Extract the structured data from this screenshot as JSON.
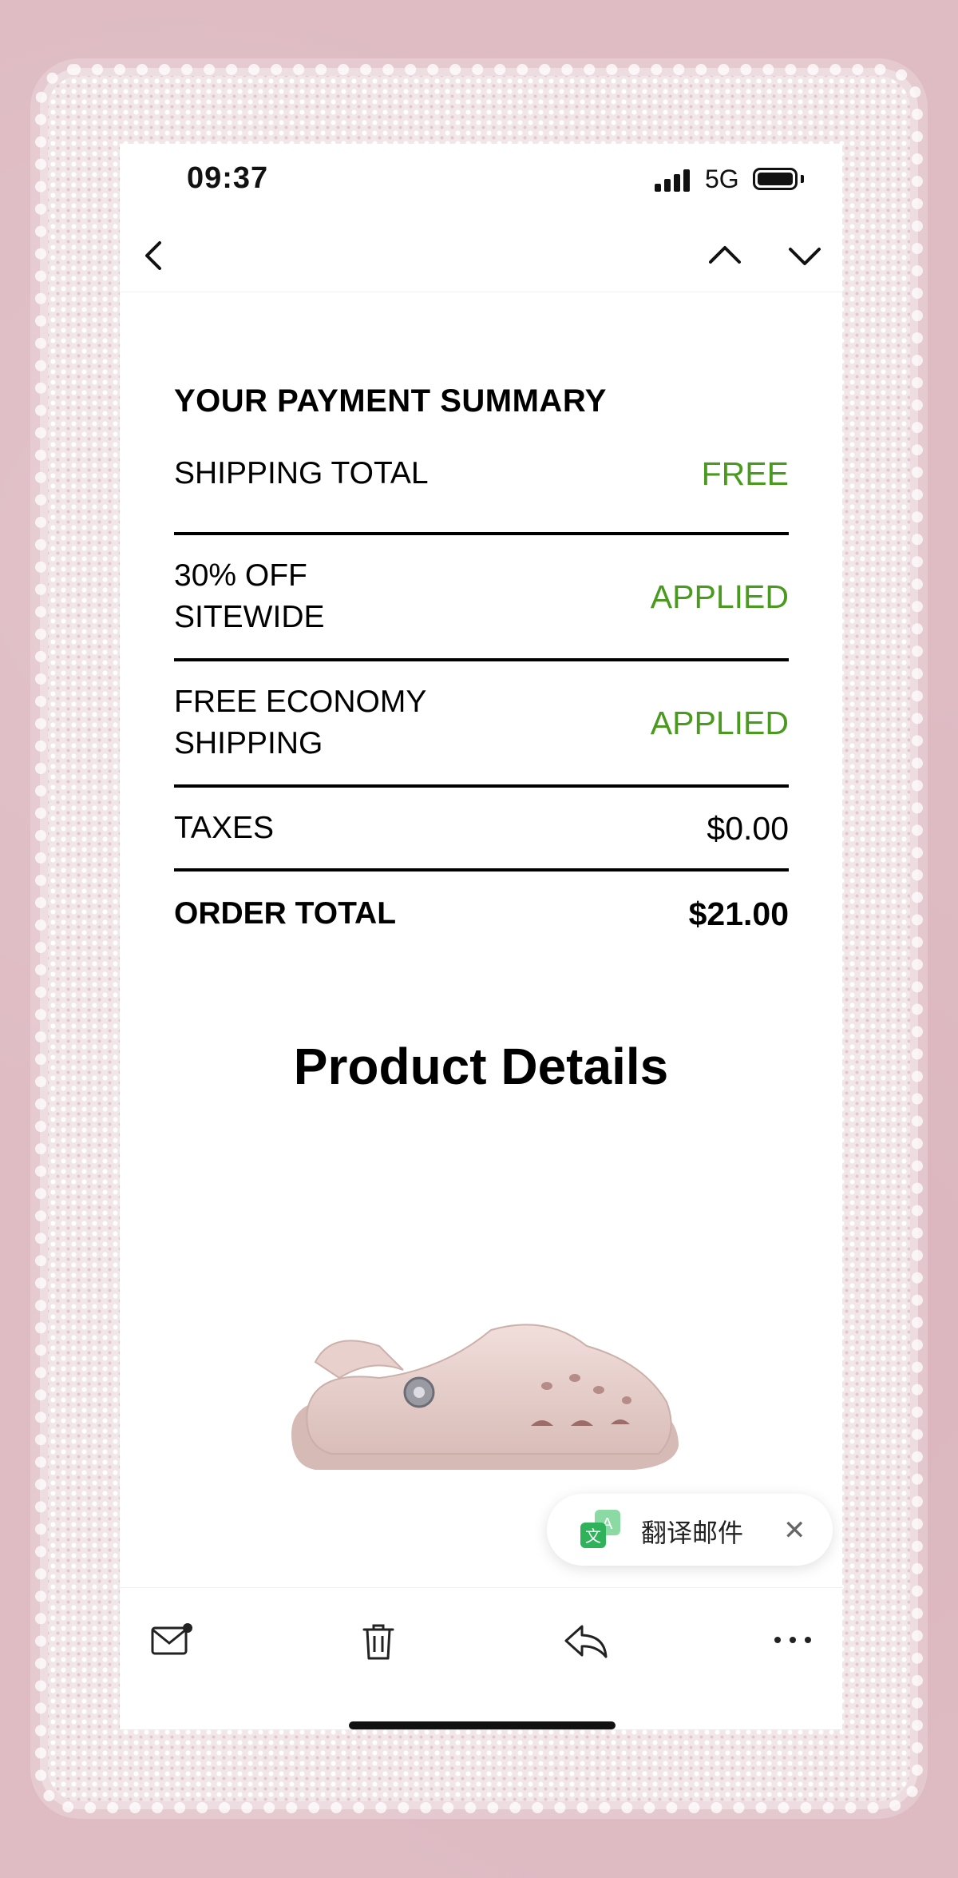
{
  "status_bar": {
    "time": "09:37",
    "network": "5G"
  },
  "navigation": {
    "back_icon": "chevron-left-icon",
    "prev_icon": "chevron-up-icon",
    "next_icon": "chevron-down-icon"
  },
  "payment_summary": {
    "title": "YOUR PAYMENT SUMMARY",
    "rows": [
      {
        "label": "SHIPPING TOTAL",
        "value": "FREE",
        "color": "#4a9a1f"
      },
      {
        "label": "30% OFF\nSITEWIDE",
        "value": "APPLIED",
        "color": "#4a9a1f"
      },
      {
        "label": "FREE ECONOMY\nSHIPPING",
        "value": "APPLIED",
        "color": "#4a9a1f"
      },
      {
        "label": "TAXES",
        "value": "$0.00",
        "color": "#000000"
      },
      {
        "label": "ORDER TOTAL",
        "value": "$21.00",
        "color": "#000000"
      }
    ]
  },
  "product_details": {
    "title": "Product Details",
    "image": "pink-clog-shoe"
  },
  "translate_popup": {
    "label": "翻译邮件",
    "icon": "translate-icon",
    "close_icon": "close-icon"
  },
  "toolbar": {
    "icons": [
      "mark-unread-icon",
      "trash-icon",
      "reply-icon",
      "more-icon"
    ]
  },
  "colors": {
    "accent_green": "#4a9a1f",
    "background_pink": "#dfbcc4"
  }
}
